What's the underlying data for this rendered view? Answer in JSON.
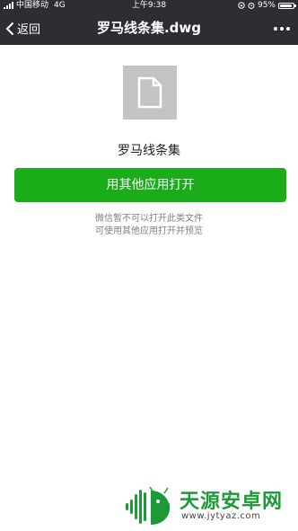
{
  "status_bar": {
    "carrier": "中国移动",
    "network": "4G",
    "time": "上午9:38",
    "battery_percent": "95%",
    "battery_level": 0.95
  },
  "nav": {
    "back_label": "返回",
    "title": "罗马线条集.dwg",
    "more_icon": "more-dots-icon"
  },
  "file": {
    "icon": "document-icon",
    "name": "罗马线条集"
  },
  "actions": {
    "open_with_other_app": "用其他应用打开"
  },
  "notice": {
    "line1": "微信暂不可以打开此类文件",
    "line2": "可使用其他应用打开并预览"
  },
  "watermark": {
    "name": "天源安卓网",
    "url": "www.jytyaz.com"
  },
  "colors": {
    "header_bg": "#2e2e32",
    "primary_green": "#1aad19",
    "file_icon_bg": "#c3c3c3",
    "watermark_green": "#1d9a38"
  }
}
